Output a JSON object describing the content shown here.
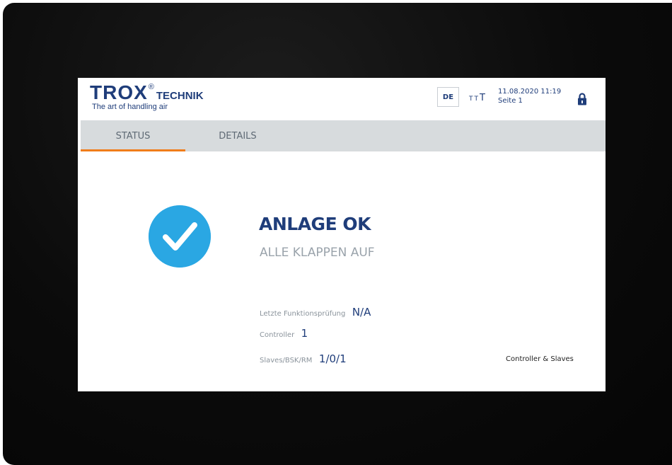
{
  "header": {
    "logo": {
      "brand": "TROX",
      "registered": "®",
      "suffix": "TECHNIK",
      "tagline": "The art of handling air"
    },
    "language_button": "DE",
    "font_size_toggle": {
      "small": "T",
      "large": "T"
    },
    "date_time": "11.08.2020 11:19",
    "page": "Seite 1",
    "lock_icon": "lock-icon"
  },
  "tabs": [
    {
      "label": "STATUS",
      "active": true
    },
    {
      "label": "DETAILS",
      "active": false
    }
  ],
  "status": {
    "icon": "checkmark-circle-icon",
    "title": "ANLAGE OK",
    "subtitle": "ALLE KLAPPEN AUF"
  },
  "info": {
    "last_test_label": "Letzte Funktionsprüfung",
    "last_test_value": "N/A",
    "controller_label": "Controller",
    "controller_value": "1",
    "slaves_label": "Slaves/BSK/RM",
    "slaves_value": "1/0/1"
  },
  "links": {
    "controller_slaves": "Controller & Slaves"
  },
  "colors": {
    "brand_blue": "#1f3d7a",
    "accent_orange": "#f07d1a",
    "check_blue": "#2aa7e3",
    "tab_bar": "#d7dbdd"
  }
}
